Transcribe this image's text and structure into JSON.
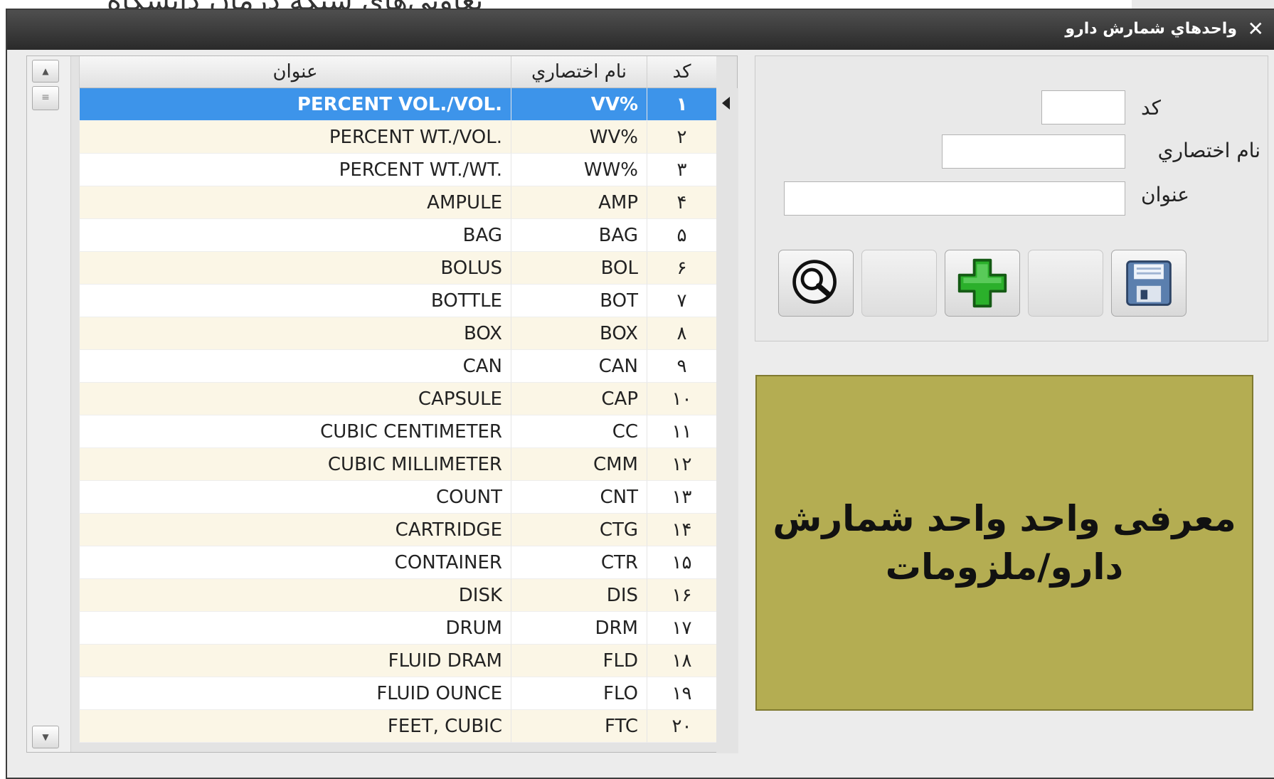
{
  "background_window": {
    "title_fragment": "تعاونی‌های شبکه درمان دانشگاه"
  },
  "dialog": {
    "title": "واحدهاي شمارش دارو",
    "close_glyph": "✕"
  },
  "grid": {
    "headers": {
      "title": "عنوان",
      "abbreviation": "نام اختصاري",
      "code": "كد"
    },
    "rows": [
      {
        "code": "۱",
        "abbr": "VV%",
        "title": "PERCENT VOL./VOL.",
        "selected": true
      },
      {
        "code": "۲",
        "abbr": "WV%",
        "title": "PERCENT WT./VOL."
      },
      {
        "code": "۳",
        "abbr": "WW%",
        "title": "PERCENT WT./WT."
      },
      {
        "code": "۴",
        "abbr": "AMP",
        "title": "AMPULE"
      },
      {
        "code": "۵",
        "abbr": "BAG",
        "title": "BAG"
      },
      {
        "code": "۶",
        "abbr": "BOL",
        "title": "BOLUS"
      },
      {
        "code": "۷",
        "abbr": "BOT",
        "title": "BOTTLE"
      },
      {
        "code": "۸",
        "abbr": "BOX",
        "title": "BOX"
      },
      {
        "code": "۹",
        "abbr": "CAN",
        "title": "CAN"
      },
      {
        "code": "۱۰",
        "abbr": "CAP",
        "title": "CAPSULE"
      },
      {
        "code": "۱۱",
        "abbr": "CC",
        "title": "CUBIC CENTIMETER"
      },
      {
        "code": "۱۲",
        "abbr": "CMM",
        "title": "CUBIC MILLIMETER"
      },
      {
        "code": "۱۳",
        "abbr": "CNT",
        "title": "COUNT"
      },
      {
        "code": "۱۴",
        "abbr": "CTG",
        "title": "CARTRIDGE"
      },
      {
        "code": "۱۵",
        "abbr": "CTR",
        "title": "CONTAINER"
      },
      {
        "code": "۱۶",
        "abbr": "DIS",
        "title": "DISK"
      },
      {
        "code": "۱۷",
        "abbr": "DRM",
        "title": "DRUM"
      },
      {
        "code": "۱۸",
        "abbr": "FLD",
        "title": "FLUID DRAM"
      },
      {
        "code": "۱۹",
        "abbr": "FLO",
        "title": "FLUID OUNCE"
      },
      {
        "code": "۲۰",
        "abbr": "FTC",
        "title": "FEET, CUBIC"
      }
    ]
  },
  "form": {
    "code_label": "كد",
    "code_value": "",
    "abbr_label": "نام اختصاري",
    "abbr_value": "",
    "title_label": "عنوان",
    "title_value": ""
  },
  "toolbar": {
    "icons": [
      "search-icon",
      "add-icon",
      "save-icon"
    ],
    "colors": {
      "add": "#2bb02b",
      "save": "#5b7fae"
    }
  },
  "note": {
    "line1": "معرفی واحد واحد شمارش",
    "line2": "دارو/ملزومات",
    "color": "#b4ad52"
  }
}
